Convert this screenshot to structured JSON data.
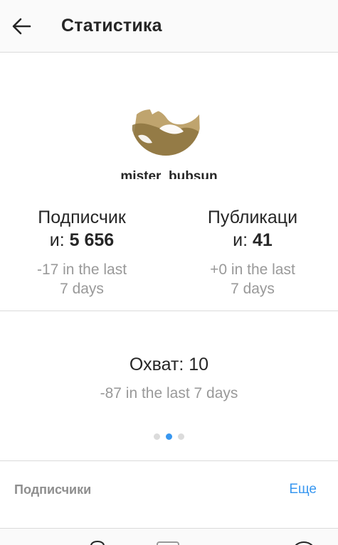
{
  "header": {
    "title": "Статистика",
    "back_icon": "arrow-left-icon"
  },
  "profile": {
    "username": "mister_bubsun"
  },
  "stats": {
    "followers": {
      "label_line1": "Подписчик",
      "label_line2": "и: ",
      "value": "5 656",
      "delta_line1": "-17 in the last",
      "delta_line2": "7 days"
    },
    "posts": {
      "label_line1": "Публикаци",
      "label_line2": "и: ",
      "value": "41",
      "delta_line1": "+0 in the last",
      "delta_line2": "7 days"
    }
  },
  "reach": {
    "label": "Охват: 10",
    "delta": "-87 in the last 7 days"
  },
  "pager": {
    "count": 3,
    "active_index": 1
  },
  "followers_section": {
    "title": "Подписчики",
    "more_label": "Еще"
  },
  "colors": {
    "accent": "#3897f0",
    "muted": "#999999",
    "divider": "#dbdbdb"
  }
}
